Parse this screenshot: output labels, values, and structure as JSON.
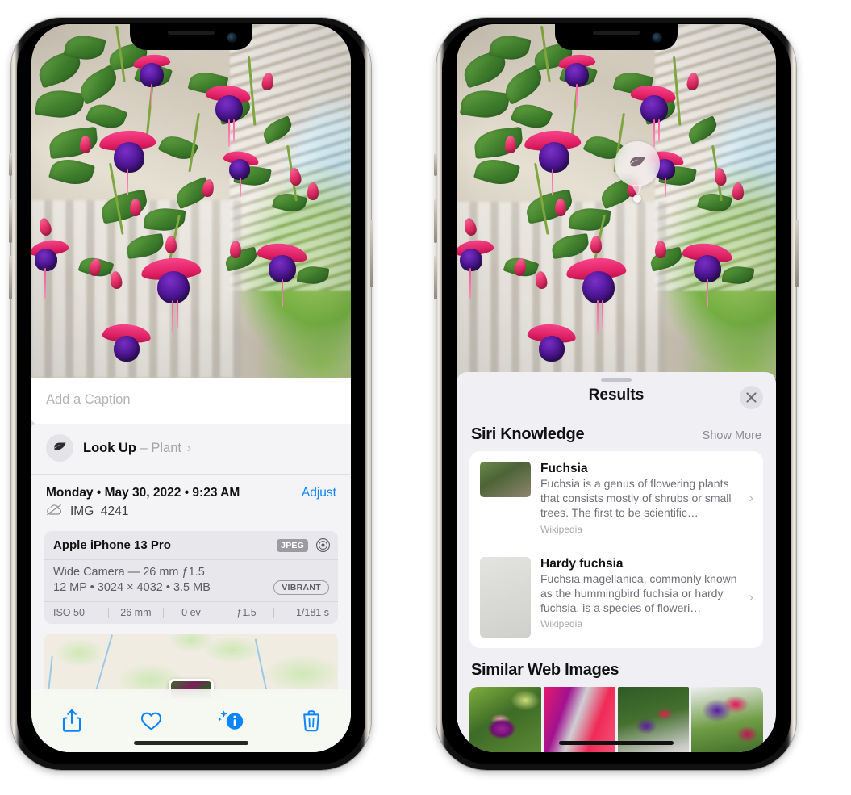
{
  "left_phone": {
    "name": "photos-detail-view",
    "caption_field": {
      "placeholder": "Add a Caption",
      "value": ""
    },
    "lookup_row": {
      "icon": "leaf-icon",
      "sparkle_icon": "sparkle-icon",
      "label": "Look Up",
      "dash": "–",
      "subject": "Plant",
      "chevron": "›"
    },
    "metadata": {
      "date_line": "Monday • May 30, 2022 • 9:23 AM",
      "adjust_label": "Adjust",
      "cloud_icon": "icloud-slash-icon",
      "filename": "IMG_4241"
    },
    "camera_card": {
      "model": "Apple iPhone 13 Pro",
      "format_tag": "JPEG",
      "aperture_icon": "aperture-icon",
      "lens_line": "Wide Camera — 26 mm ƒ1.5",
      "size_line": "12 MP • 3024 × 4032 • 3.5 MB",
      "style_pill": "VIBRANT",
      "exif": [
        "ISO 50",
        "26 mm",
        "0 ev",
        "ƒ1.5",
        "1/181 s"
      ]
    },
    "map": {
      "name": "location-map-preview",
      "pin_icon": "photo-pin-thumbnail"
    },
    "toolbar": [
      {
        "name": "share-button",
        "icon": "share-icon"
      },
      {
        "name": "favorite-button",
        "icon": "heart-icon"
      },
      {
        "name": "info-button",
        "icon": "info-sparkle-icon"
      },
      {
        "name": "delete-button",
        "icon": "trash-icon"
      }
    ],
    "accent_color": "#0a84ff"
  },
  "right_phone": {
    "name": "visual-look-up-results",
    "photo_badge": {
      "icon": "leaf-icon",
      "label": "visual-look-up-leaf-badge"
    },
    "sheet": {
      "grabber": "drag-handle",
      "title": "Results",
      "close_icon": "close-icon"
    },
    "siri_knowledge": {
      "title": "Siri Knowledge",
      "action": "Show More",
      "items": [
        {
          "title": "Fuchsia",
          "description": "Fuchsia is a genus of flowering plants that consists mostly of shrubs or small trees. The first to be scientific…",
          "source": "Wikipedia",
          "thumb": "fuchsia-red-flowers-thumbnail",
          "chevron": "›"
        },
        {
          "title": "Hardy fuchsia",
          "description": "Fuchsia magellanica, commonly known as the hummingbird fuchsia or hardy fuchsia, is a species of floweri…",
          "source": "Wikipedia",
          "thumb": "hardy-fuchsia-specimen-thumbnail",
          "chevron": "›"
        }
      ]
    },
    "similar_web_images": {
      "title": "Similar Web Images",
      "thumbs": [
        "fuchsia-magenta-on-green-thumbnail",
        "fuchsia-red-closeup-thumbnail",
        "fuchsia-bush-red-purple-thumbnail",
        "fuchsia-purple-hanging-thumbnail"
      ]
    }
  },
  "colors": {
    "accent": "#0a84ff",
    "sheet_bg": "#f0eff4",
    "info_bg": "#f4f4f7",
    "card_bg": "#e7e7ec",
    "secondary_text": "#6f6f76"
  }
}
